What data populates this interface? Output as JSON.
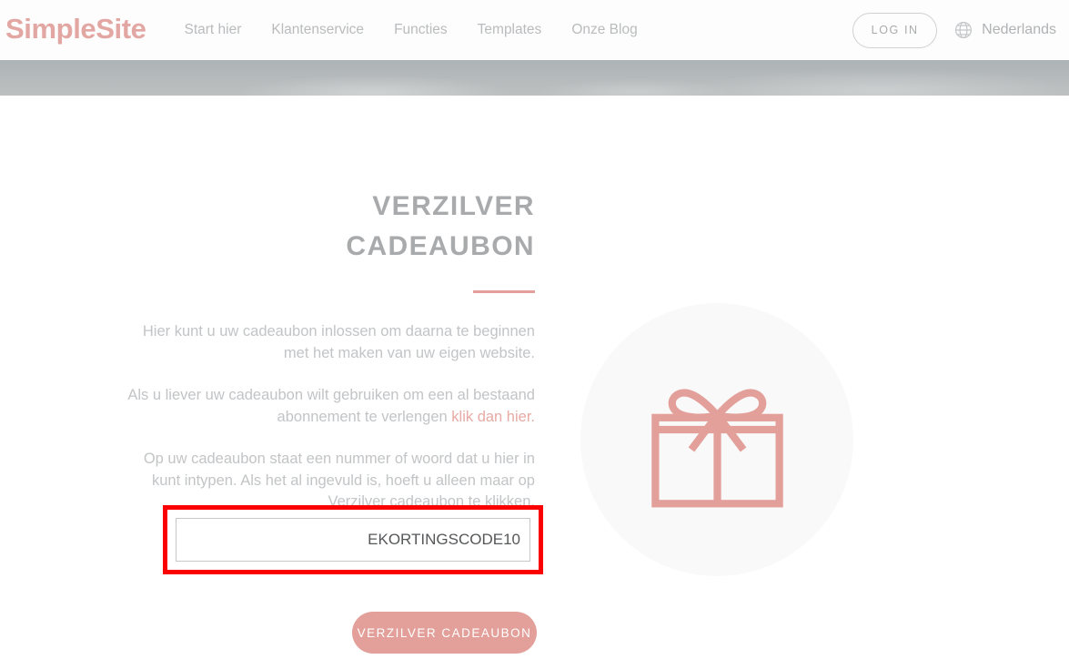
{
  "header": {
    "logo": "SimpleSite",
    "nav": [
      {
        "label": "Start hier"
      },
      {
        "label": "Klantenservice"
      },
      {
        "label": "Functies"
      },
      {
        "label": "Templates"
      },
      {
        "label": "Onze Blog"
      }
    ],
    "login_label": "LOG IN",
    "language": "Nederlands",
    "globe_icon": "globe-icon",
    "accent_color": "#e3a7a3",
    "nav_text_color": "#b9bbbd"
  },
  "banner": {
    "background_color": "#b4b9bb"
  },
  "main": {
    "title_line1": "VERZILVER",
    "title_line2": "CADEAUBON",
    "rule_color": "#e3a09a",
    "paragraph1": "Hier kunt u uw cadeaubon inlossen om daarna te beginnen met het maken van uw eigen website.",
    "paragraph2_before": "Als u liever uw cadeaubon wilt gebruiken om een al bestaand abonnement te verlengen ",
    "paragraph2_link": "klik dan hier.",
    "paragraph3": "Op uw cadeaubon staat een nummer of woord dat u hier in kunt intypen. Als het al ingevuld is, hoeft u alleen maar op Verzilver cadeaubon te klikken.",
    "coupon_value": "EKORTINGSCODE10",
    "coupon_placeholder": "",
    "submit_label": "VERZILVER CADEAUBON",
    "submit_color": "#e3a09a",
    "gift_icon": "gift-box-icon",
    "gift_icon_color": "#e3a09a",
    "gift_circle_color": "#f9f9f9",
    "highlight_color": "#fb0000"
  }
}
